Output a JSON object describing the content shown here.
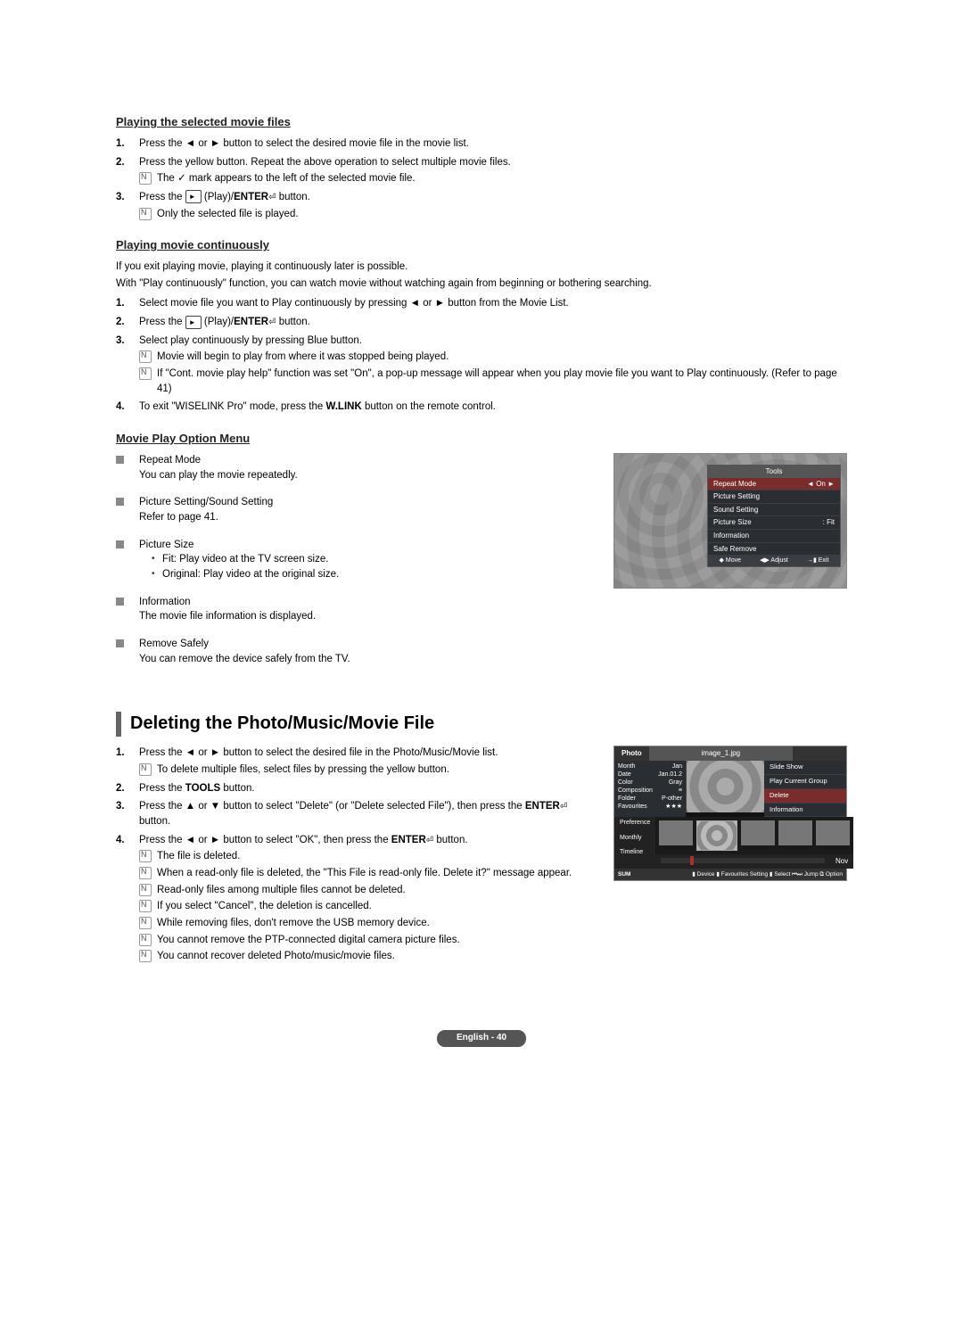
{
  "section1": {
    "h1": "Playing the selected movie files",
    "s1_1": "Press the ◄ or ► button to select the desired movie file in the movie list.",
    "s1_2": "Press the yellow button. Repeat the above operation to select multiple movie files.",
    "s1_2n": "The ✓ mark appears to the left of the selected movie file.",
    "s1_3a": "Press the ",
    "s1_3b": " (Play)/",
    "enterLabel": "ENTER",
    "s1_3c": " button.",
    "s1_3n": "Only the selected file is played."
  },
  "section2": {
    "h2": "Playing movie continuously",
    "intro1": "If you exit playing movie, playing it continuously later is possible.",
    "intro2": "With \"Play continuously\" function, you can watch movie without watching again from beginning or bothering searching.",
    "s2_1": "Select movie file you want to Play continuously by pressing ◄ or ► button from the Movie List.",
    "s2_2a": "Press the ",
    "s2_2b": " (Play)/",
    "s2_2c": " button.",
    "s2_3": "Select play continuously by pressing Blue button.",
    "s2_3n1": "Movie will begin to play from where it was stopped being played.",
    "s2_3n2": "If \"Cont. movie play help\" function was set \"On\", a pop-up message will appear when you play movie file you want to Play continuously. (Refer to page 41)",
    "s2_4a": "To exit \"WISELINK Pro\" mode, press the ",
    "wlink": "W.LINK",
    "s2_4b": " button on the remote control."
  },
  "section3": {
    "h3": "Movie Play Option Menu",
    "items": [
      {
        "t": "Repeat Mode",
        "d": "You can play the movie repeatedly."
      },
      {
        "t": "Picture Setting/Sound Setting",
        "d": "Refer to page 41."
      },
      {
        "t": "Picture Size",
        "sub1": "Fit: Play video at the TV screen size.",
        "sub2": "Original: Play video at the original size."
      },
      {
        "t": "Information",
        "d": "The movie file information is displayed."
      },
      {
        "t": "Remove Safely",
        "d": "You can remove the device safely from the TV."
      }
    ]
  },
  "toolsPanel": {
    "title": "Tools",
    "rows": [
      {
        "l": "Repeat Mode",
        "r": "◄   On   ►",
        "hl": true
      },
      {
        "l": "Picture Setting",
        "r": ""
      },
      {
        "l": "Sound Setting",
        "r": ""
      },
      {
        "l": "Picture Size",
        "r": ":      Fit"
      },
      {
        "l": "Information",
        "r": ""
      },
      {
        "l": "Safe Remove",
        "r": ""
      }
    ],
    "foot": {
      "move": "◆ Move",
      "adjust": "◀▶ Adjust",
      "exit": "→▮ Exit"
    }
  },
  "section4": {
    "title": "Deleting the Photo/Music/Movie File",
    "s4_1": "Press the ◄ or ► button to select the desired file in the Photo/Music/Movie list.",
    "s4_1n": "To delete multiple files, select files by pressing the yellow button.",
    "s4_2a": "Press the ",
    "tools": "TOOLS",
    "s4_2b": " button.",
    "s4_3a": "Press the ▲ or ▼ button to select \"Delete\" (or \"Delete selected File\"), then press the ",
    "s4_3b": " button.",
    "s4_4a": "Press the ◄ or ► button to select \"OK\", then press the ",
    "s4_4b": " button.",
    "notes": [
      "The file is deleted.",
      "When a read-only file is deleted, the \"This File is read-only file. Delete it?\" message appear.",
      "Read-only files among multiple files cannot be deleted.",
      "If you select \"Cancel\", the deletion is cancelled.",
      "While removing files, don't remove the USB memory device.",
      "You cannot remove the PTP-connected digital camera picture files.",
      "You cannot recover deleted Photo/music/movie files."
    ]
  },
  "photoPanel": {
    "tab": "Photo",
    "file": "image_1.jpg",
    "meta": [
      {
        "l": "Month",
        "r": "Jan"
      },
      {
        "l": "Date",
        "r": "Jan.01.2"
      },
      {
        "l": "Color",
        "r": "Gray"
      },
      {
        "l": "Composition",
        "r": "≡"
      },
      {
        "l": "Folder",
        "r": "P-other"
      },
      {
        "l": "Favourites",
        "r": "★★★"
      }
    ],
    "context": [
      "Slide Show",
      "Play Current Group",
      "Delete",
      "Information"
    ],
    "contextHlIndex": 2,
    "side": [
      "Preference",
      "Monthly",
      "Timeline"
    ],
    "bottomLabel": "",
    "nov": "Nov",
    "sum": "SUM",
    "footActions": "▮ Device  ▮ Favourites Setting  ▮ Select  ⏮⏭ Jump  ⧉ Option"
  },
  "footer": "English - 40"
}
